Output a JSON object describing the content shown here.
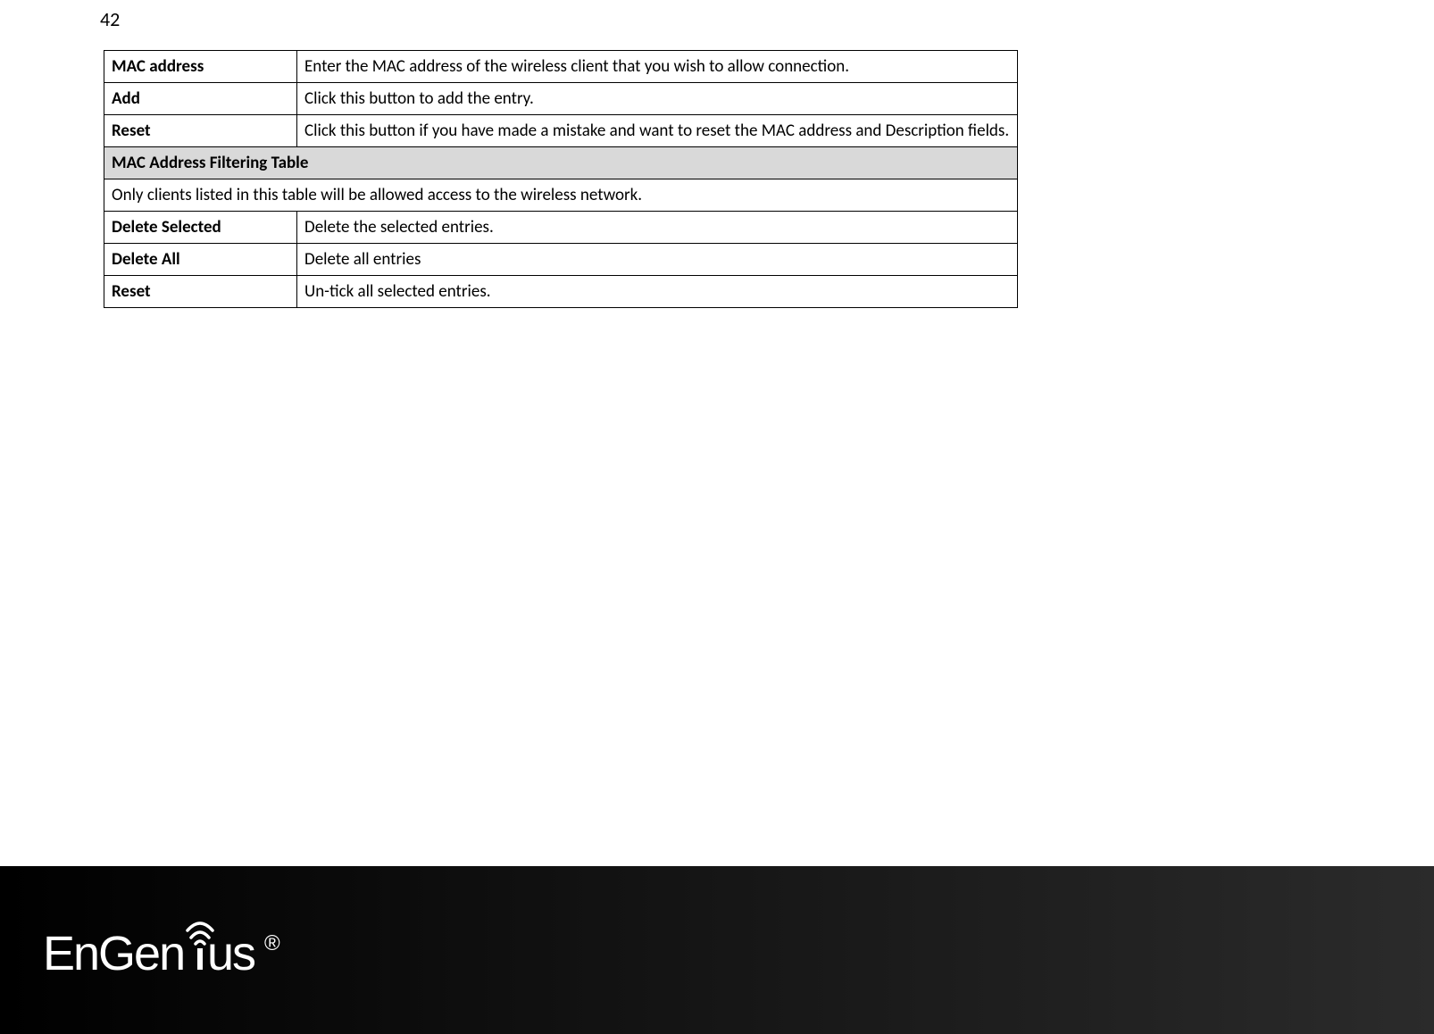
{
  "page_number": "42",
  "table": {
    "rows": [
      {
        "label": "MAC address",
        "desc": "Enter the MAC address of the wireless client that you wish to allow connection."
      },
      {
        "label": "Add",
        "desc": "Click this button to add the entry."
      },
      {
        "label": "Reset",
        "desc": "Click this button if you have made a mistake and want to reset the MAC address and Description fields."
      }
    ],
    "section_header": "MAC Address Filtering Table",
    "section_note": "Only clients listed in this table will be allowed access to the wireless network.",
    "rows2": [
      {
        "label": "Delete Selected",
        "desc": "Delete the selected entries."
      },
      {
        "label": "Delete All",
        "desc": "Delete all entries"
      },
      {
        "label": "Reset",
        "desc": "Un-tick all selected entries."
      }
    ]
  },
  "logo": {
    "brand": "EnGenius",
    "registered": "®"
  }
}
